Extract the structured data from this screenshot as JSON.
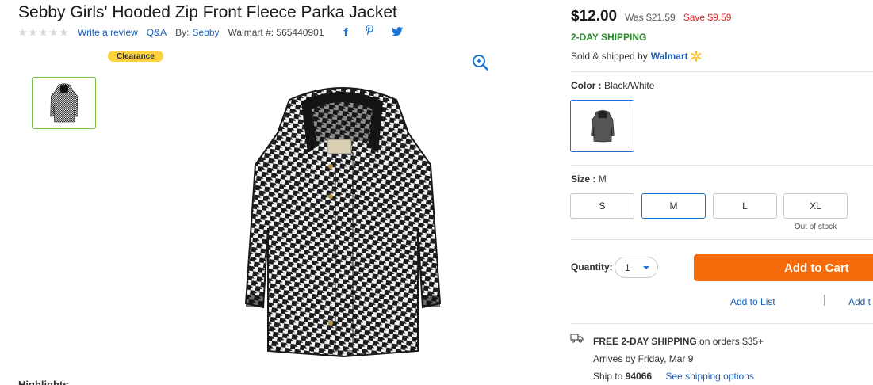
{
  "product": {
    "title": "Sebby Girls' Hooded Zip Front Fleece Parka Jacket",
    "write_review": "Write a review",
    "qa": "Q&A",
    "by_label": "By:",
    "brand": "Sebby",
    "walmart_number": "Walmart #: 565440901",
    "clearance_badge": "Clearance"
  },
  "price": {
    "current": "$12.00",
    "was": "Was $21.59",
    "save": "Save $9.59",
    "shipping_badge": "2-DAY SHIPPING",
    "sold_by_prefix": "Sold & shipped by",
    "seller": "Walmart"
  },
  "color": {
    "label": "Color :",
    "value": "Black/White"
  },
  "size": {
    "label": "Size :",
    "value": "M",
    "options": [
      "S",
      "M",
      "L",
      "XL"
    ],
    "out_of_stock_note": "Out of stock"
  },
  "quantity": {
    "label": "Quantity:",
    "value": "1"
  },
  "actions": {
    "add_to_cart": "Add to Cart",
    "add_to_list": "Add to List",
    "add_to_registry": "Add t"
  },
  "shipping": {
    "free_bold": "FREE 2-DAY SHIPPING",
    "free_rest": " on orders $35+",
    "arrives": "Arrives by Friday, Mar 9",
    "ship_to_label": "Ship to ",
    "zip": "94066",
    "see_options": "See shipping options"
  },
  "below_fold_heading": "Highlights",
  "colors": {
    "link_blue": "#1d5db3",
    "accent_blue": "#1a74d6",
    "cart_orange": "#f56b0b",
    "save_red": "#dd2222",
    "shipping_green": "#2b8a2b",
    "clearance_yellow": "#ffd23f",
    "thumb_border_green": "#76c043"
  },
  "icons": [
    "facebook-icon",
    "pinterest-icon",
    "twitter-icon",
    "zoom-in-icon",
    "walmart-spark-icon",
    "truck-icon"
  ]
}
